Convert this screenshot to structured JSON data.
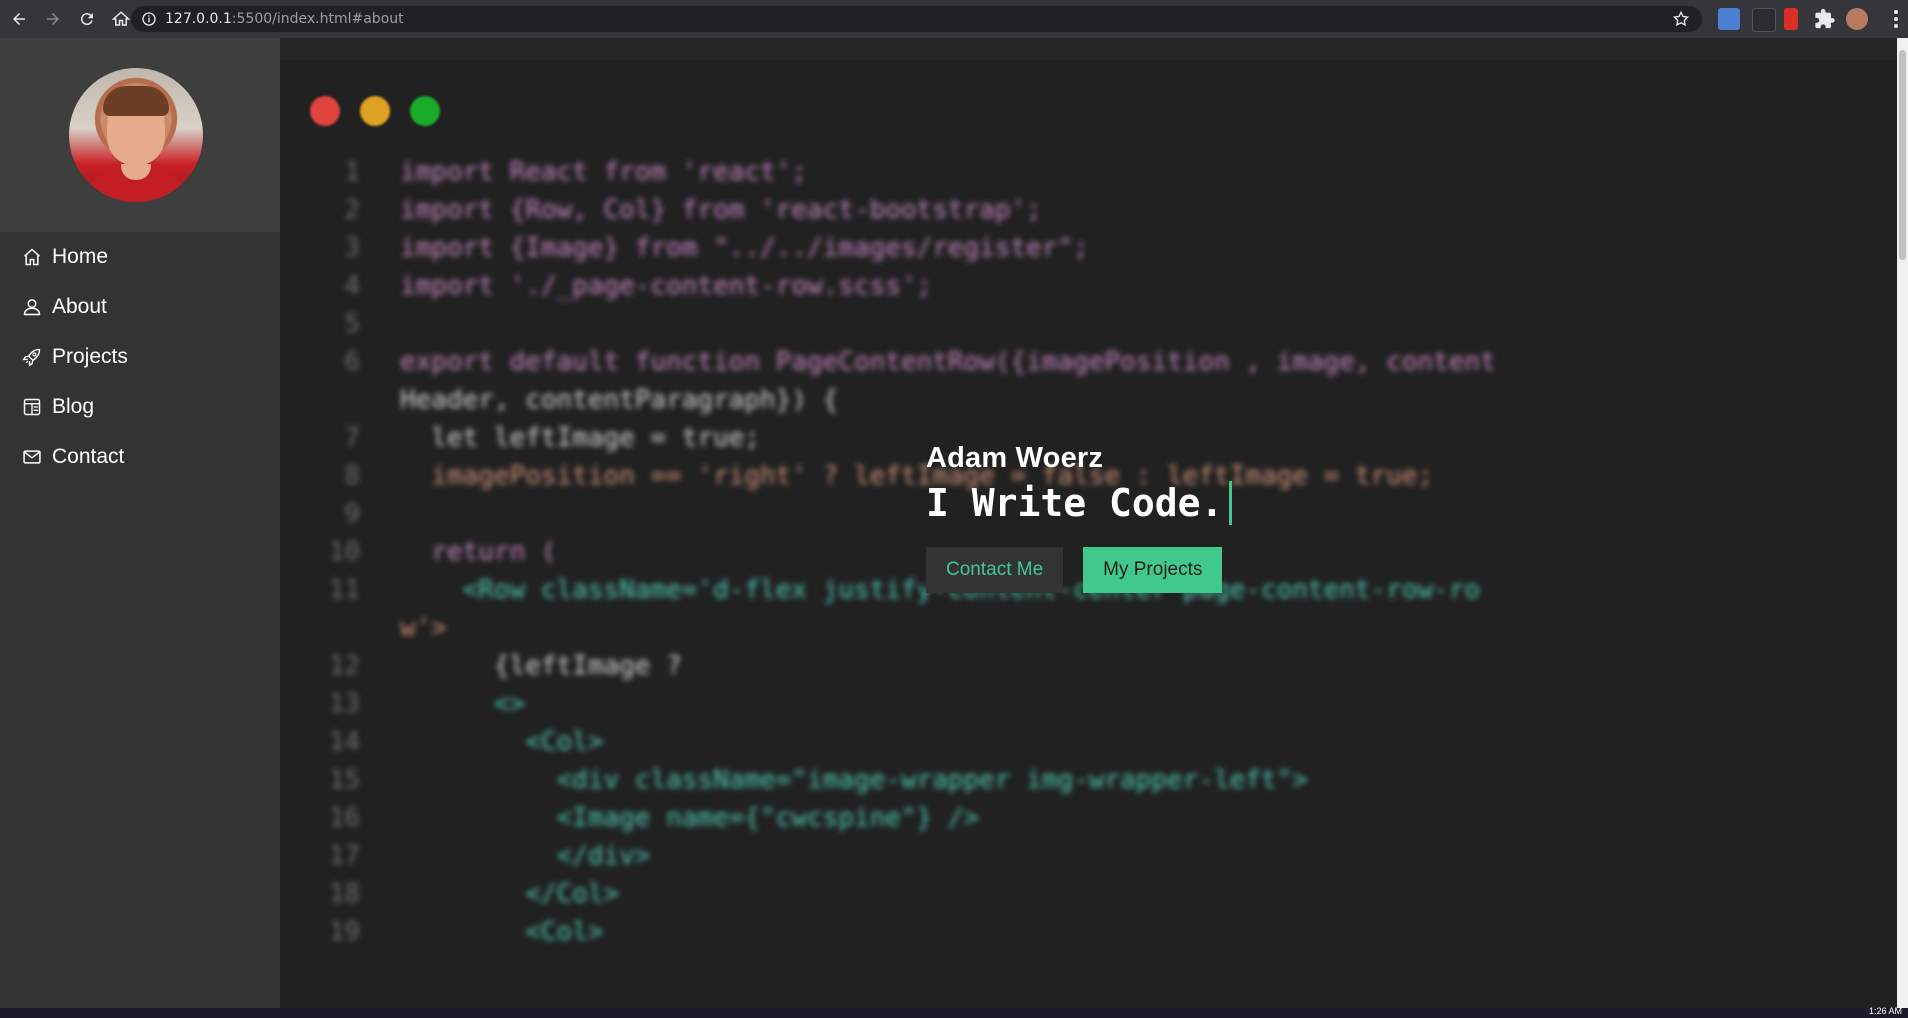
{
  "browser": {
    "url_host": "127.0.0.1",
    "url_rest": ":5500/index.html#about"
  },
  "sidebar": {
    "items": [
      {
        "label": "Home",
        "icon": "home-icon"
      },
      {
        "label": "About",
        "icon": "user-icon"
      },
      {
        "label": "Projects",
        "icon": "rocket-icon"
      },
      {
        "label": "Blog",
        "icon": "blog-icon"
      },
      {
        "label": "Contact",
        "icon": "envelope-icon"
      }
    ]
  },
  "editor": {
    "dot_colors": [
      "#e0443e",
      "#dea123",
      "#1aab29"
    ],
    "lines": [
      {
        "n": "1",
        "code": "import React from 'react';"
      },
      {
        "n": "2",
        "code": "import {Row, Col} from 'react-bootstrap';"
      },
      {
        "n": "3",
        "code": "import {Image} from \"../../images/register\";"
      },
      {
        "n": "4",
        "code": "import './_page-content-row.scss';"
      },
      {
        "n": "5",
        "code": ""
      },
      {
        "n": "6",
        "code": "export default function PageContentRow({imagePosition , image, content"
      },
      {
        "n": "",
        "code": "Header, contentParagraph}) {"
      },
      {
        "n": "7",
        "code": "  let leftImage = true;"
      },
      {
        "n": "8",
        "code": "  imagePosition == 'right' ? leftImage = false : leftImage = true;"
      },
      {
        "n": "9",
        "code": ""
      },
      {
        "n": "10",
        "code": "  return ("
      },
      {
        "n": "11",
        "code": "    <Row className='d-flex justify-content-center page-content-row-ro"
      },
      {
        "n": "",
        "code": "w'>"
      },
      {
        "n": "12",
        "code": "      {leftImage ?"
      },
      {
        "n": "13",
        "code": "      <>"
      },
      {
        "n": "14",
        "code": "        <Col>"
      },
      {
        "n": "15",
        "code": "          <div className=\"image-wrapper img-wrapper-left\">"
      },
      {
        "n": "16",
        "code": "          <Image name={\"cwcspine\"} />"
      },
      {
        "n": "17",
        "code": "          </div>"
      },
      {
        "n": "18",
        "code": "        </Col>"
      },
      {
        "n": "19",
        "code": "        <Col>"
      }
    ]
  },
  "hero": {
    "name": "Adam Woerz",
    "tagline": "I Write Code.",
    "contact_label": "Contact Me",
    "projects_label": "My Projects"
  },
  "taskbar": {
    "clock": "1:26 AM"
  },
  "colors": {
    "accent": "#41c98c",
    "sidebar": "#333333",
    "editor_bg": "#212121"
  }
}
